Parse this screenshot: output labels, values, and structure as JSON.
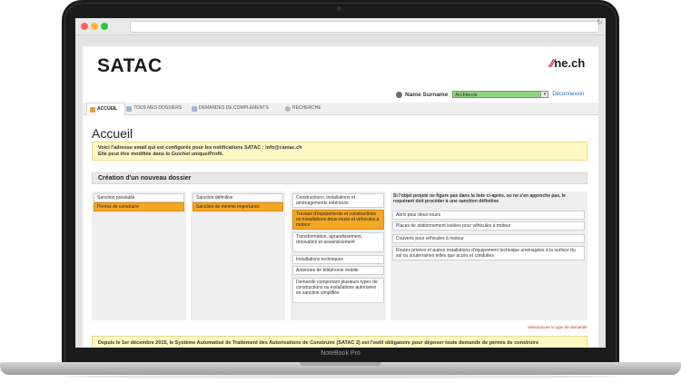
{
  "app": {
    "logo": "SATAC",
    "partner_logo": {
      "mark": "∕∕",
      "text": "ne.ch"
    }
  },
  "user": {
    "label": "Name Surname",
    "role": "Architecte",
    "logout": "Déconnexion"
  },
  "tabs": [
    {
      "label": "ACCUEIL",
      "icon": "home-icon",
      "active": true
    },
    {
      "label": "TOUS MES DOSSIERS",
      "icon": "folder-icon",
      "active": false
    },
    {
      "label": "DEMANDES DE COMPLÉMENTS",
      "icon": "list-icon",
      "active": false
    },
    {
      "label": "RECHERCHE",
      "icon": "search-icon",
      "active": false
    }
  ],
  "page": {
    "title": "Accueil",
    "notice_line1": "Voici l'adresse email qui est configurée pour les notifications SATAC : info@camac.ch",
    "notice_line2": "Elle peut être modifiée dans le Guichet unique/Profil.",
    "section_title": "Création d'un nouveau dossier",
    "hint": "Sélectionner le type de demande",
    "bottom_notice": "Depuis le 1er décembre 2015, le Système Automatisé de Traitement des Autorisations de Construire (SATAC 2) est l'outil obligatoire pour déposer toute demande de permis de construire"
  },
  "columns": {
    "col1": [
      {
        "label": "Sanction préalable",
        "selected": false
      },
      {
        "label": "Permis de construire",
        "selected": true
      }
    ],
    "col2": [
      {
        "label": "Sanction définitive",
        "selected": false
      },
      {
        "label": "Sanction de minime importance",
        "selected": true
      }
    ],
    "col3": [
      {
        "label": "Constructions, installations et aménagements extérieurs",
        "selected": false
      },
      {
        "label": "Travaux d'équipements et constructions ou installations deux-roues et véhicules à moteur",
        "selected": true
      },
      {
        "label": "Transformation, agrandissement, rénovation et assainissement",
        "selected": false
      },
      {
        "label": "Installations techniques",
        "selected": false
      },
      {
        "label": "Antennes de téléphonie mobile",
        "selected": false
      },
      {
        "label": "Demande comportant plusieurs types de constructions ou installations autorisées en sanction simplifiée",
        "selected": false
      }
    ],
    "col4_header": "Si l'objet projeté ne figure pas dans la liste ci-après, ou ne s'en approche pas, le requérant doit procéder à une sanction définitive",
    "col4": [
      {
        "label": "Abris pour deux-roues"
      },
      {
        "label": "Places de stationnement isolées pour véhicules à moteur"
      },
      {
        "label": "Couverts pour véhicules à moteur"
      },
      {
        "label": "Routes privées et autres installations d'équipement technique aménagées à la surface du sol ou souterraines telles que accès et conduites"
      }
    ]
  },
  "device": {
    "brand": "NoteBook Pro"
  },
  "colors": {
    "selected": "#f5a623",
    "notice_bg": "#fff8c4",
    "role_bg": "#8fd47f",
    "link": "#1a6fbf"
  }
}
